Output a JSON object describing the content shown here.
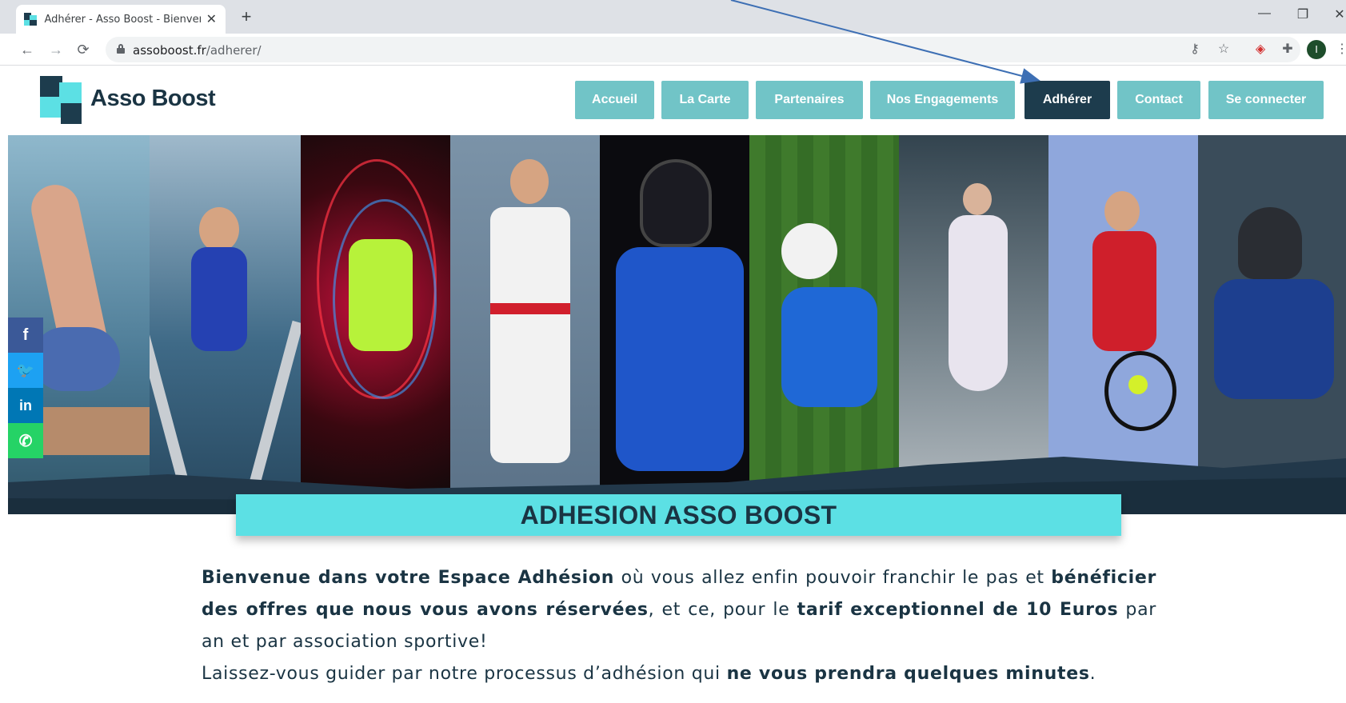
{
  "browser": {
    "tab_title": "Adhérer - Asso Boost - Bienvenue",
    "tab_close": "✕",
    "new_tab": "+",
    "url_host": "assoboost.fr",
    "url_path": "/adherer/",
    "profile_initial": "I",
    "window_controls": [
      "—",
      "❐",
      "✕"
    ],
    "icons": [
      "back-arrow-icon",
      "forward-arrow-icon",
      "reload-icon",
      "lock-icon",
      "key-icon",
      "star-icon",
      "pocket-icon",
      "puzzle-icon",
      "kebab-menu-icon"
    ]
  },
  "site": {
    "logo_text": "Asso Boost",
    "nav": [
      {
        "label": "Accueil",
        "active": false
      },
      {
        "label": "La Carte",
        "active": false
      },
      {
        "label": "Partenaires",
        "active": false
      },
      {
        "label": "Nos Engagements",
        "active": false
      },
      {
        "label": "Adhérer",
        "active": true
      },
      {
        "label": "Contact",
        "active": false
      },
      {
        "label": "Se connecter",
        "active": false
      }
    ],
    "hero_panels": [
      "gymnastics",
      "gymnastics-rings",
      "badminton",
      "karate",
      "ice-hockey",
      "football",
      "figure-skating",
      "tennis",
      "hockey"
    ],
    "banner_title": "ADHESION ASSO BOOST",
    "social": [
      {
        "name": "facebook",
        "glyph": "f",
        "color": "#3b5998"
      },
      {
        "name": "twitter",
        "glyph": "🐦",
        "color": "#1da1f2"
      },
      {
        "name": "linkedin",
        "glyph": "in",
        "color": "#0077b5"
      },
      {
        "name": "whatsapp",
        "glyph": "✆",
        "color": "#25d366"
      }
    ],
    "intro": {
      "b1": "Bienvenue dans votre Espace Adhésion",
      "t1": " où vous allez enfin pouvoir franchir le pas et ",
      "b2": "bénéficier des offres que nous vous avons réservées",
      "t2": ", et ce, pour le ",
      "b3": "tarif exceptionnel de 10 Euros",
      "t3": " par an et par association sportive!",
      "t4": "Laissez-vous guider par notre processus d’adhésion qui ",
      "b4": "ne vous prendra quelques minutes",
      "t5": "."
    }
  },
  "colors": {
    "nav_bg": "#71c4c7",
    "nav_active": "#1d3c4d",
    "banner": "#5ce0e4",
    "text": "#1a3443",
    "annotation_arrow": "#3d6fb4"
  }
}
